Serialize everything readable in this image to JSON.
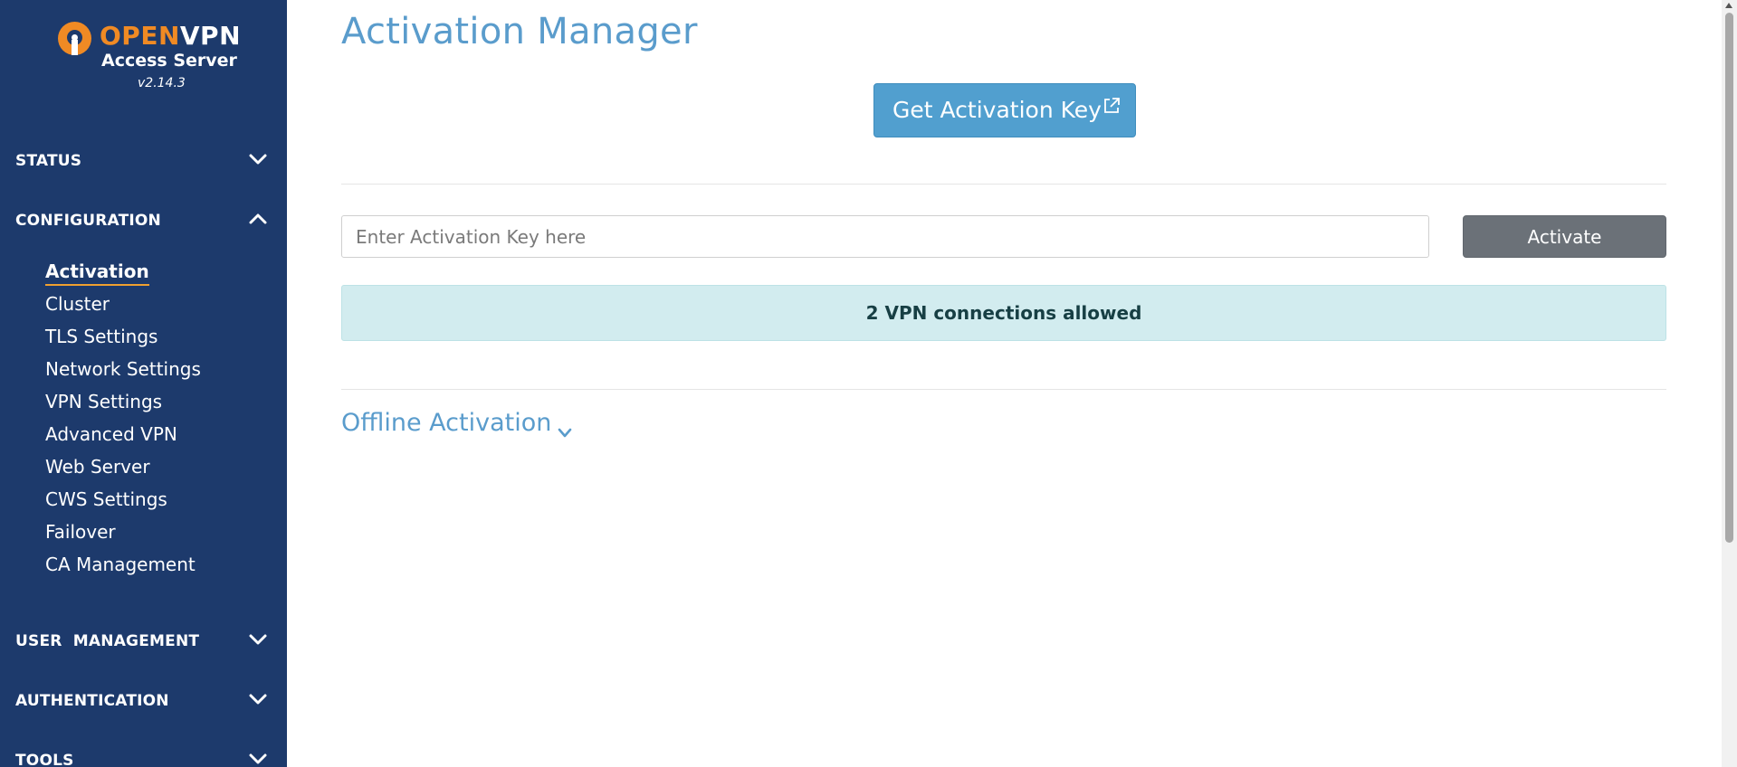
{
  "brand": {
    "name_open": "OPEN",
    "name_vpn": "VPN",
    "product": "Access Server",
    "version": "v2.14.3",
    "colors": {
      "sidebar": "#1d3a6c",
      "accent_orange": "#f08a24",
      "title_blue": "#5a9ccc"
    }
  },
  "sidebar": {
    "sections": [
      {
        "label": "STATUS",
        "expanded": false,
        "icon": "chevron-down-icon"
      },
      {
        "label": "CONFIGURATION",
        "expanded": true,
        "icon": "chevron-up-icon"
      },
      {
        "label": "USER  MANAGEMENT",
        "expanded": false,
        "icon": "chevron-down-icon"
      },
      {
        "label": "AUTHENTICATION",
        "expanded": false,
        "icon": "chevron-down-icon"
      },
      {
        "label": "TOOLS",
        "expanded": false,
        "icon": "chevron-down-icon"
      }
    ],
    "configuration_items": [
      {
        "label": "Activation",
        "active": true
      },
      {
        "label": "Cluster"
      },
      {
        "label": "TLS Settings"
      },
      {
        "label": "Network Settings"
      },
      {
        "label": "VPN Settings"
      },
      {
        "label": "Advanced VPN"
      },
      {
        "label": "Web Server"
      },
      {
        "label": "CWS Settings"
      },
      {
        "label": "Failover"
      },
      {
        "label": "CA Management"
      }
    ]
  },
  "main": {
    "title": "Activation Manager",
    "get_key_button": "Get Activation Key",
    "get_key_icon": "external-link-icon",
    "key_input": {
      "placeholder": "Enter Activation Key here",
      "value": ""
    },
    "activate_button": "Activate",
    "info_message": "2 VPN connections allowed",
    "offline_activation": "Offline Activation"
  }
}
